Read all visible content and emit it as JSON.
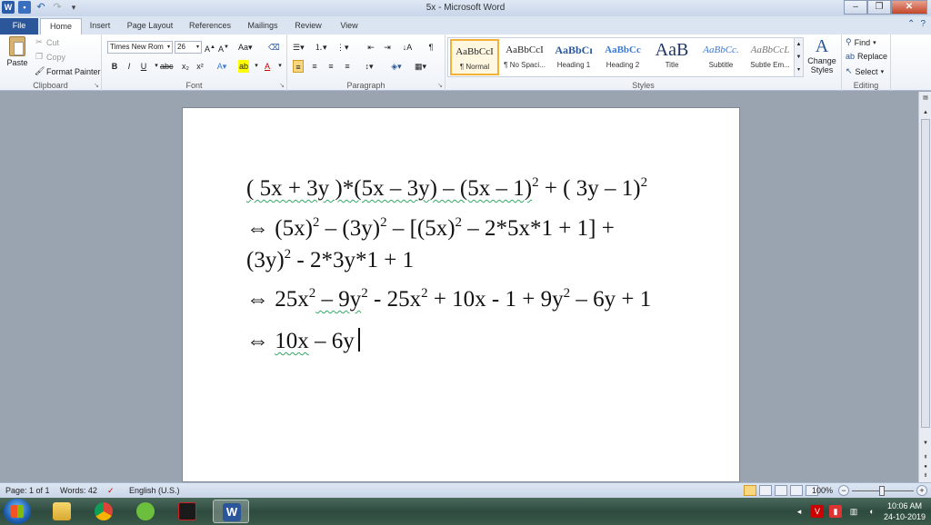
{
  "window": {
    "title": "5x - Microsoft Word"
  },
  "tabs": [
    "File",
    "Home",
    "Insert",
    "Page Layout",
    "References",
    "Mailings",
    "Review",
    "View"
  ],
  "ribbon": {
    "clipboard": {
      "paste": "Paste",
      "cut": "Cut",
      "copy": "Copy",
      "format_painter": "Format Painter",
      "label": "Clipboard"
    },
    "font": {
      "name": "Times New Rom",
      "size": "26",
      "label": "Font"
    },
    "paragraph": {
      "label": "Paragraph"
    },
    "styles": {
      "label": "Styles",
      "items": [
        {
          "sample": "AaBbCcI",
          "name": "¶ Normal"
        },
        {
          "sample": "AaBbCcI",
          "name": "¶ No Spaci..."
        },
        {
          "sample": "AaBbCı",
          "name": "Heading 1"
        },
        {
          "sample": "AaBbCc",
          "name": "Heading 2"
        },
        {
          "sample": "AaB",
          "name": "Title"
        },
        {
          "sample": "AaBbCc.",
          "name": "Subtitle"
        },
        {
          "sample": "AaBbCcL",
          "name": "Subtle Em..."
        }
      ],
      "change_styles": "Change Styles"
    },
    "editing": {
      "find": "Find",
      "replace": "Replace",
      "select": "Select",
      "label": "Editing"
    }
  },
  "document": {
    "line1": {
      "a": "( 5x + 3y )*(5x – 3y) – (5x – 1)",
      "b": "  + ( 3y – 1)",
      "sup": "2"
    },
    "line2": {
      "text": "⇔ (5x)",
      "t2": " – (3y)",
      "t3": " – [(5x)",
      "t4": " – 2*5x*1 + 1] +"
    },
    "line3": {
      "t1": "(3y)",
      "t2": " - 2*3y*1 + 1"
    },
    "line4": {
      "arrow": "⇔ ",
      "t1": "25x",
      "t2": " – 9y",
      "t3": " - 25x",
      "t4": " + 10x - 1 + 9y",
      "t5": " – 6y + 1"
    },
    "line5": {
      "arrow": "⇔ ",
      "t1": "10x",
      "t2": " – 6y"
    }
  },
  "status": {
    "page": "Page: 1 of 1",
    "words": "Words: 42",
    "language": "English (U.S.)",
    "zoom": "100%"
  },
  "taskbar": {
    "time": "10:06 AM",
    "date": "24-10-2019"
  }
}
